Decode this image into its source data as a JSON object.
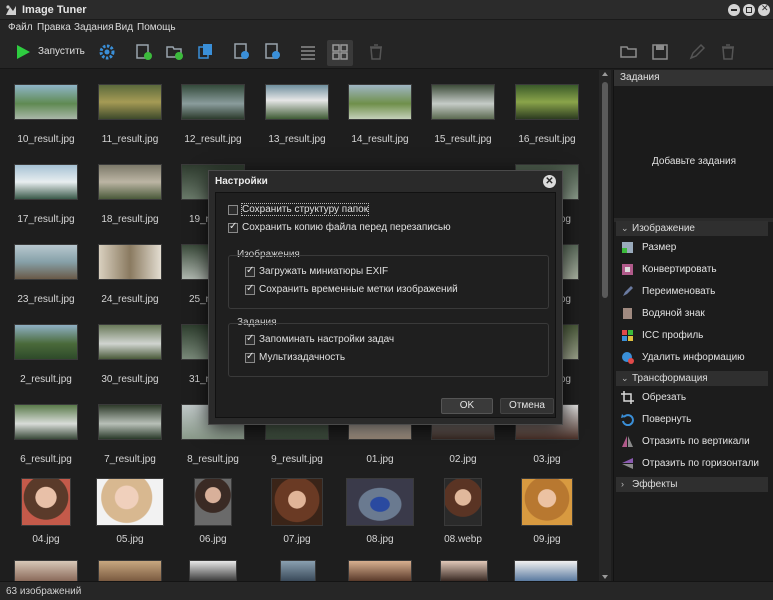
{
  "app": {
    "title": "Image Tuner",
    "controls": [
      "minimize-icon",
      "maximize-icon",
      "close-icon"
    ]
  },
  "menu": [
    "Файл",
    "Правка",
    "Задания",
    "Вид",
    "Помощь"
  ],
  "toolbar": {
    "run_label": "Запустить",
    "icons": [
      "play-icon",
      "settings-icon",
      "add-image-icon",
      "add-folder-icon",
      "copy-icon",
      "image-info-icon",
      "image-info-blue-icon",
      "list-view-icon",
      "grid-view-icon",
      "trash-icon",
      "open-folder-icon",
      "save-icon",
      "edit-icon",
      "delete-icon"
    ]
  },
  "gallery": {
    "rows": [
      [
        "10_result.jpg",
        "11_result.jpg",
        "12_result.jpg",
        "13_result.jpg",
        "14_result.jpg",
        "15_result.jpg",
        "16_result.jpg"
      ],
      [
        "17_result.jpg",
        "18_result.jpg",
        "19_re",
        "",
        "",
        "",
        "jpg"
      ],
      [
        "23_result.jpg",
        "24_result.jpg",
        "25_re",
        "",
        "",
        "",
        "jpg"
      ],
      [
        "2_result.jpg",
        "30_result.jpg",
        "31_re",
        "",
        "",
        "",
        "jpg"
      ],
      [
        "6_result.jpg",
        "7_result.jpg",
        "8_result.jpg",
        "9_result.jpg",
        "01.jpg",
        "02.jpg",
        "03.jpg"
      ],
      [
        "04.jpg",
        "05.jpg",
        "06.jpg",
        "07.jpg",
        "08.jpg",
        "08.webp",
        "09.jpg"
      ]
    ]
  },
  "right_panel": {
    "header": "Задания",
    "empty_text": "Добавьте задания",
    "sections": [
      {
        "label": "Изображение",
        "tools": [
          {
            "label": "Размер",
            "icon": "resize-icon"
          },
          {
            "label": "Конвертировать",
            "icon": "convert-icon"
          },
          {
            "label": "Переименовать",
            "icon": "rename-icon"
          },
          {
            "label": "Водяной знак",
            "icon": "watermark-icon"
          },
          {
            "label": "ICC профиль",
            "icon": "icc-profile-icon"
          },
          {
            "label": "Удалить информацию",
            "icon": "remove-info-icon"
          }
        ]
      },
      {
        "label": "Трансформация",
        "tools": [
          {
            "label": "Обрезать",
            "icon": "crop-icon"
          },
          {
            "label": "Повернуть",
            "icon": "rotate-icon"
          },
          {
            "label": "Отразить по вертикали",
            "icon": "flip-vertical-icon"
          },
          {
            "label": "Отразить по горизонтали",
            "icon": "flip-horizontal-icon"
          }
        ]
      },
      {
        "label": "Эффекты",
        "tools": []
      }
    ]
  },
  "status": {
    "text": "63 изображений"
  },
  "dialog": {
    "title": "Настройки",
    "options": [
      {
        "label": "Сохранить структуру папок",
        "checked": false
      },
      {
        "label": "Сохранить копию файла перед перезаписью",
        "checked": true
      }
    ],
    "groups": [
      {
        "label": "Изображения",
        "options": [
          {
            "label": "Загружать миниатюры EXIF",
            "checked": true
          },
          {
            "label": "Сохранить временные метки изображений",
            "checked": true
          }
        ]
      },
      {
        "label": "Задания",
        "options": [
          {
            "label": "Запоминать настройки задач",
            "checked": true
          },
          {
            "label": "Мультизадачность",
            "checked": true
          }
        ]
      }
    ],
    "ok_label": "OK",
    "cancel_label": "Отмена"
  },
  "colors": {
    "run": "#2ecc40",
    "accent_blue": "#3a8fd8",
    "tool_green": "#3cba3c"
  }
}
